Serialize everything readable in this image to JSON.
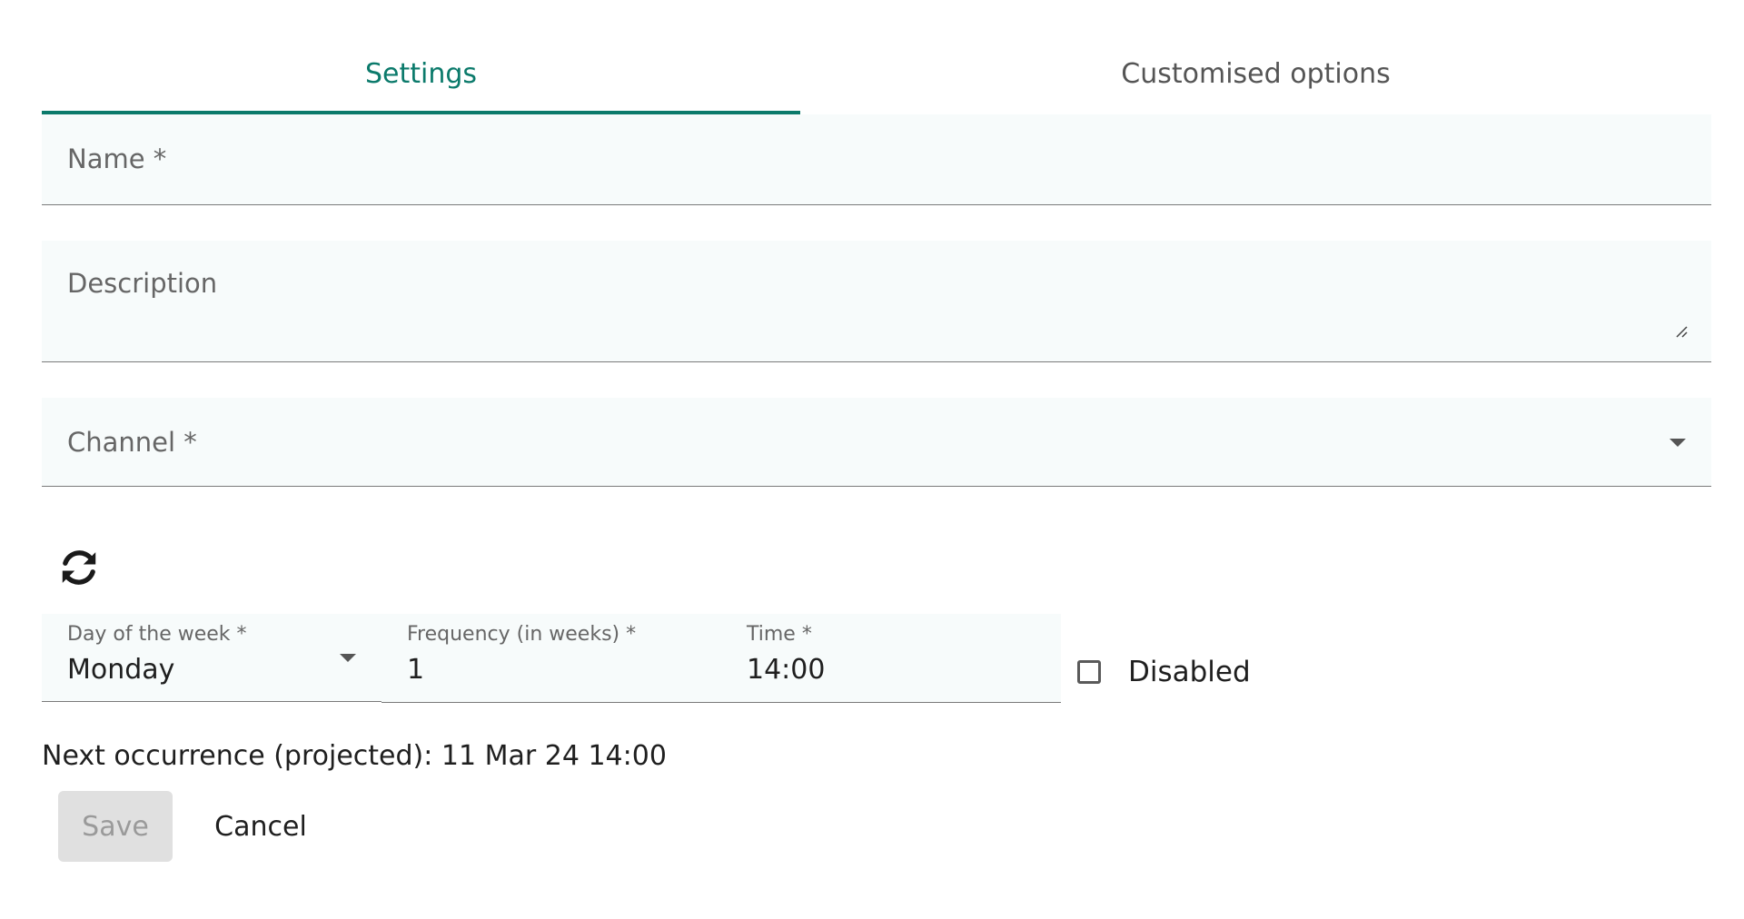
{
  "tabs": [
    {
      "label": "Settings",
      "active": true
    },
    {
      "label": "Customised options",
      "active": false
    }
  ],
  "form": {
    "name_label": "Name *",
    "description_label": "Description",
    "channel_label": "Channel *"
  },
  "schedule": {
    "day_label": "Day of the week *",
    "day_value": "Monday",
    "frequency_label": "Frequency (in weeks) *",
    "frequency_value": "1",
    "time_label": "Time *",
    "time_value": "14:00",
    "disabled_label": "Disabled",
    "disabled_checked": false
  },
  "next_occurrence": "Next occurrence (projected): 11 Mar 24 14:00",
  "actions": {
    "save_label": "Save",
    "cancel_label": "Cancel"
  },
  "colors": {
    "accent": "#0b7a6b",
    "field_bg": "#f7fbfb",
    "disabled_button_bg": "#e0e0e0"
  },
  "icons": {
    "repeat": "repeat-icon",
    "dropdown": "chevron-down-icon",
    "resize": "resize-grip-icon"
  }
}
